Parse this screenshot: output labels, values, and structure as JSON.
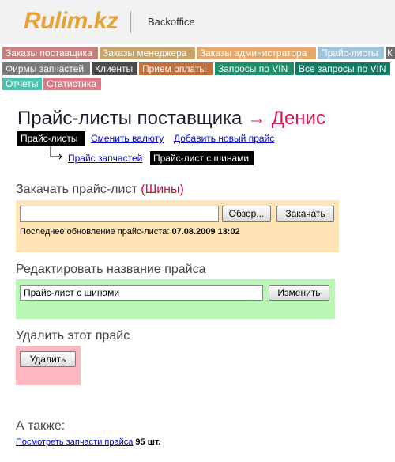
{
  "header": {
    "logo": "Rulim.kz",
    "subtitle": "Backoffice"
  },
  "nav": {
    "row1": [
      {
        "label": "Заказы поставщика",
        "color": "#c97f7f"
      },
      {
        "label": "Заказы менеджера",
        "color": "#c9a46a"
      },
      {
        "label": "Заказы администратора",
        "color": "#e8a86a"
      },
      {
        "label": "Прайс-листы",
        "color": "#9ec4d8"
      },
      {
        "label": "К",
        "color": "#6c6c6c"
      }
    ],
    "row2": [
      {
        "label": "Фирмы запчастей",
        "color": "#7a7a7a"
      },
      {
        "label": "Клиенты",
        "color": "#4a4a4a"
      },
      {
        "label": "Прием оплаты",
        "color": "#c0703c"
      },
      {
        "label": "Запросы по VIN",
        "color": "#1f8f6a"
      },
      {
        "label": "Все запросы по VIN",
        "color": "#137a64"
      }
    ],
    "row3": [
      {
        "label": "Отчеты",
        "color": "#4fc0b0"
      },
      {
        "label": "Статистика",
        "color": "#d97a86"
      }
    ]
  },
  "page": {
    "title": "Прайс-листы поставщика",
    "arrow": "→",
    "supplier": "Денис"
  },
  "subnav": {
    "active_tab": "Прайс-листы",
    "change_currency": "Сменить валюту",
    "add_price": "Добавить новый прайс",
    "parts_price": "Прайс запчастей",
    "tires_price": "Прайс-лист с шинами"
  },
  "upload": {
    "title_prefix": "Закачать прайс-лист",
    "title_highlight": "(Шины)",
    "browse_label": "Обзор...",
    "upload_label": "Закачать",
    "file_value": "",
    "last_update_label": "Последнее обновление прайс-листа:",
    "last_update_value": "07.08.2009 13:02"
  },
  "rename": {
    "title": "Редактировать название прайса",
    "name_value": "Прайс-лист с шинами",
    "submit_label": "Изменить"
  },
  "delete": {
    "title": "Удалить этот прайс",
    "button_label": "Удалить"
  },
  "also": {
    "title": "А также:",
    "view_parts_link": "Посмотреть запчасти прайса",
    "count": "95 шт."
  }
}
